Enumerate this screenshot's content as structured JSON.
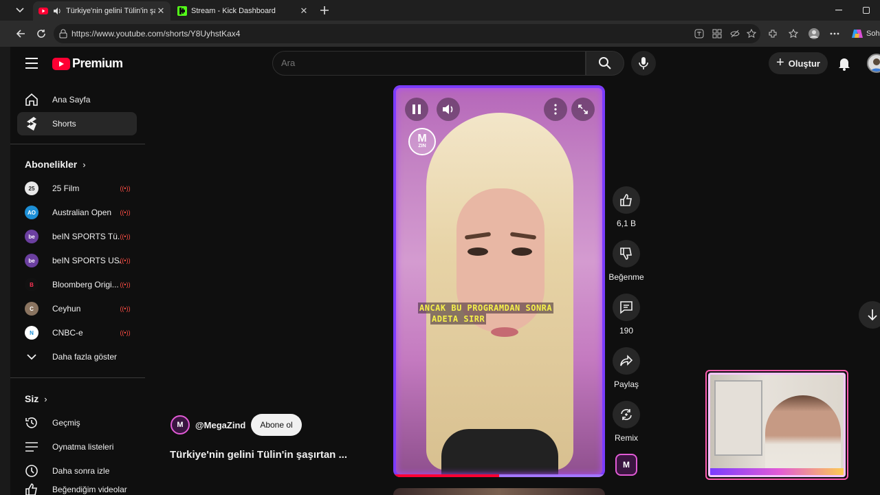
{
  "browser": {
    "tabs": [
      {
        "title": "Türkiye'nin gelini Tülin'in şaşırt",
        "active": true
      },
      {
        "title": "Stream - Kick Dashboard",
        "active": false
      }
    ],
    "url": "https://www.youtube.com/shorts/Y8UyhstKax4",
    "copilot_label": "Soh"
  },
  "header": {
    "logo_text": "Premium",
    "search_placeholder": "Ara",
    "create_label": "Oluştur"
  },
  "sidebar": {
    "main": [
      {
        "label": "Ana Sayfa",
        "icon": "home-icon",
        "selected": false
      },
      {
        "label": "Shorts",
        "icon": "shorts-icon",
        "selected": true
      }
    ],
    "subscriptions_title": "Abonelikler",
    "subscriptions": [
      {
        "label": "25 Film",
        "avatar_text": "25",
        "color": "#e8e8e8"
      },
      {
        "label": "Australian Open",
        "avatar_text": "AO",
        "color": "#1d8fd6"
      },
      {
        "label": "beIN SPORTS Tü...",
        "avatar_text": "be",
        "color": "#6b3fa0"
      },
      {
        "label": "beIN SPORTS USA",
        "avatar_text": "be",
        "color": "#6b3fa0"
      },
      {
        "label": "Bloomberg Origi...",
        "avatar_text": "B",
        "color": "#111111"
      },
      {
        "label": "Ceyhun",
        "avatar_text": "C",
        "color": "#8a7460"
      },
      {
        "label": "CNBC-e",
        "avatar_text": "N",
        "color": "#ffffff"
      }
    ],
    "show_more": "Daha fazla göster",
    "you_title": "Siz",
    "you": [
      {
        "label": "Geçmiş",
        "icon": "history-icon"
      },
      {
        "label": "Oynatma listeleri",
        "icon": "playlist-icon"
      },
      {
        "label": "Daha sonra izle",
        "icon": "clock-icon"
      },
      {
        "label": "Beğendiğim videolar",
        "icon": "like-icon"
      }
    ]
  },
  "short": {
    "caption_line1": "ANCAK BU PROGRAMDAN SONRA",
    "caption_line2": "ADETA SIRR",
    "logo_main": "M",
    "logo_sub": "ZIN",
    "progress": 0.5,
    "channel": "@MegaZind",
    "subscribe_label": "Abone ol",
    "title": "Türkiye'nin gelini Tülin'in şaşırtan ...",
    "likes": "6,1 B",
    "dislike_label": "Beğenme",
    "comments": "190",
    "share_label": "Paylaş",
    "remix_label": "Remix"
  }
}
